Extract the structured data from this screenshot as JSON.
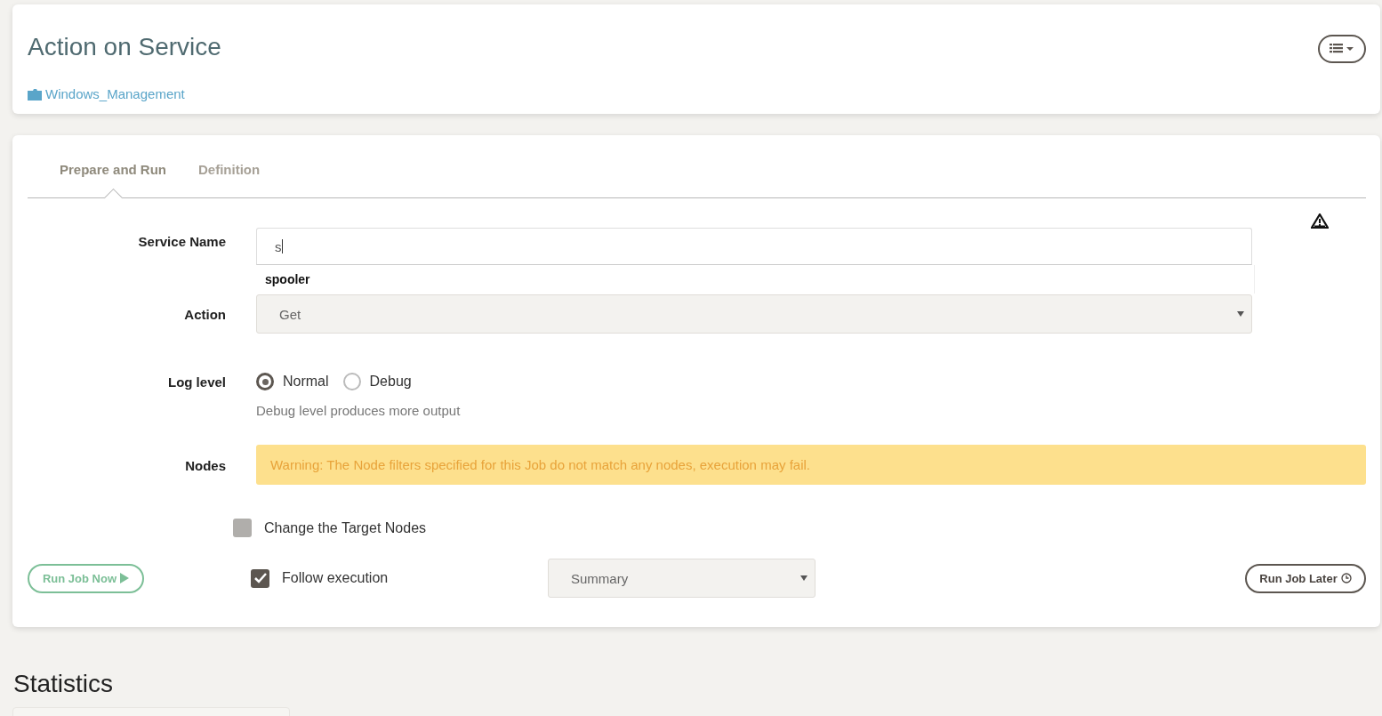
{
  "header": {
    "title": "Action on Service",
    "breadcrumb": "Windows_Management"
  },
  "tabs": [
    {
      "label": "Prepare and Run",
      "selected": true
    },
    {
      "label": "Definition",
      "selected": false
    }
  ],
  "options": [
    {
      "kind": "autocomplete",
      "label": "Service Name",
      "value": "s",
      "suggestions": [
        "spooler"
      ],
      "warning": true
    },
    {
      "kind": "select",
      "label": "Action",
      "value": "Get"
    },
    {
      "kind": "radio",
      "label": "Log level",
      "choices": [
        {
          "label": "Normal",
          "selected": true
        },
        {
          "label": "Debug",
          "selected": false
        }
      ],
      "help": "Debug level produces more output"
    },
    {
      "kind": "warning",
      "label": "Nodes",
      "message": "Warning: The Node filters specified for this Job do not match any nodes, execution may fail."
    }
  ],
  "change_target": {
    "label": "Change the Target Nodes",
    "checked": false
  },
  "run_now": {
    "label": "Run Job Now"
  },
  "follow": {
    "label": "Follow execution",
    "checked": true
  },
  "follow_mode": {
    "value": "Summary"
  },
  "run_later": {
    "label": "Run Job Later"
  },
  "statistics": {
    "title": "Statistics"
  }
}
